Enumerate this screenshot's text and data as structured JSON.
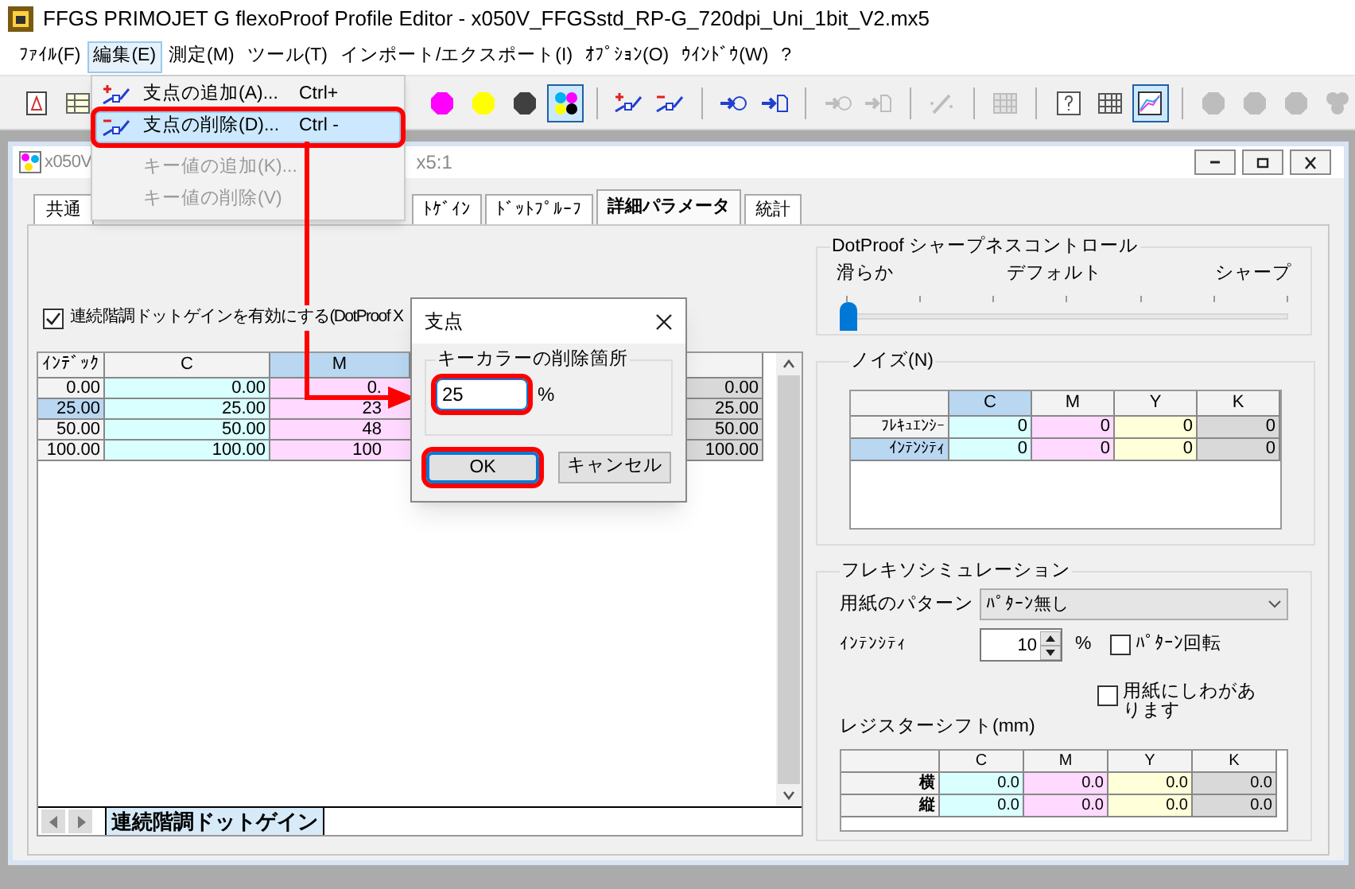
{
  "window": {
    "title": "FFGS PRIMOJET G flexoProof Profile Editor - x050V_FFGSstd_RP-G_720dpi_Uni_1bit_V2.mx5"
  },
  "menu_bar": [
    {
      "label": "ﾌｧｲﾙ(F)",
      "selected": false
    },
    {
      "label": "編集(E)",
      "selected": true
    },
    {
      "label": "測定(M)",
      "selected": false
    },
    {
      "label": "ツール(T)",
      "selected": false
    },
    {
      "label": "インポート/エクスポート(I)",
      "selected": false
    },
    {
      "label": "ｵﾌﾟｼｮﾝ(O)",
      "selected": false
    },
    {
      "label": "ｳｲﾝﾄﾞｳ(W)",
      "selected": false
    },
    {
      "label": "?",
      "selected": false
    }
  ],
  "toolbar": [
    {
      "kind": "document",
      "selected": false,
      "disabled": false
    },
    {
      "kind": "table",
      "selected": false,
      "disabled": false
    },
    {
      "kind": "gap"
    },
    {
      "kind": "dot",
      "color": "#ff00ff",
      "selected": false,
      "disabled": false
    },
    {
      "kind": "dot",
      "color": "#ffff00",
      "selected": false,
      "disabled": false
    },
    {
      "kind": "dot",
      "color": "#404040",
      "selected": false,
      "disabled": false
    },
    {
      "kind": "cmyk",
      "selected": true,
      "disabled": false
    },
    {
      "kind": "separator"
    },
    {
      "kind": "add-point",
      "selected": false,
      "disabled": false
    },
    {
      "kind": "delete-point",
      "selected": false,
      "disabled": false
    },
    {
      "kind": "separator"
    },
    {
      "kind": "import",
      "selected": false,
      "disabled": false
    },
    {
      "kind": "export",
      "selected": false,
      "disabled": false
    },
    {
      "kind": "separator"
    },
    {
      "kind": "import",
      "selected": false,
      "disabled": true
    },
    {
      "kind": "export",
      "selected": false,
      "disabled": true
    },
    {
      "kind": "separator"
    },
    {
      "kind": "wand",
      "selected": false,
      "disabled": true
    },
    {
      "kind": "separator"
    },
    {
      "kind": "grid",
      "selected": false,
      "disabled": true
    },
    {
      "kind": "separator"
    },
    {
      "kind": "help",
      "selected": false,
      "disabled": false
    },
    {
      "kind": "grid",
      "selected": false,
      "disabled": false
    },
    {
      "kind": "chart",
      "selected": true,
      "disabled": false
    },
    {
      "kind": "separator"
    },
    {
      "kind": "dot",
      "selected": false,
      "disabled": true
    },
    {
      "kind": "dot",
      "selected": false,
      "disabled": true
    },
    {
      "kind": "dot",
      "selected": false,
      "disabled": true
    },
    {
      "kind": "cluster",
      "selected": false,
      "disabled": true
    }
  ],
  "edit_menu": [
    {
      "kind": "add-point",
      "label": "支点の追加(A)...",
      "shortcut": "Ctrl+",
      "disabled": false,
      "selected": false,
      "highlighted": false
    },
    {
      "kind": "delete-point",
      "label": "支点の削除(D)...",
      "shortcut": "Ctrl -",
      "disabled": false,
      "selected": true,
      "highlighted": true
    },
    {
      "kind": "plain",
      "label": "キー値の追加(K)...",
      "disabled": true,
      "selected": false,
      "highlighted": false
    },
    {
      "kind": "plain",
      "label": "キー値の削除(V)",
      "disabled": true,
      "selected": false,
      "highlighted": false
    }
  ],
  "document": {
    "title_start": "x050V",
    "title_end": "x5:1",
    "tabs": [
      {
        "label": "共通",
        "selected": false
      },
      {
        "kind": "hidden"
      },
      {
        "label": "ﾄｹﾞｲﾝ",
        "selected": false
      },
      {
        "label": "ﾄﾞｯﾄﾌﾟﾙｰﾌ",
        "selected": false
      },
      {
        "label": "詳細パラメータ",
        "selected": true
      },
      {
        "label": "統計",
        "selected": false
      }
    ],
    "tone_gain": {
      "checkbox": {
        "label": "連続階調ドットゲインを有効にする(DotProof X",
        "checked": true
      },
      "columns": [
        {
          "label": "ｲﾝﾃﾞｯｸ",
          "selected": false
        },
        {
          "label": "C",
          "selected": false
        },
        {
          "label": "M",
          "selected": true
        }
      ],
      "rows": [
        {
          "index": "0.00",
          "selected": false,
          "c": "0.00",
          "m": "0.",
          "column_5": "0.00"
        },
        {
          "index": "25.00",
          "selected": true,
          "c": "25.00",
          "m": "23",
          "column_5": "25.00"
        },
        {
          "index": "50.00",
          "selected": false,
          "c": "50.00",
          "m": "48",
          "column_5": "50.00"
        },
        {
          "index": "100.00",
          "selected": false,
          "c": "100.00",
          "m": "100",
          "column_5": "100.00"
        }
      ],
      "sheet_tabs": [
        {
          "label": "連続階調ドットゲイン",
          "selected": true
        }
      ]
    },
    "sharpness": {
      "title": "DotProof シャープネスコントロール",
      "labels": [
        "滑らか",
        "デフォルト",
        "シャープ"
      ],
      "level": 0
    },
    "noise": {
      "title": "ノイズ(N)",
      "columns": [
        {
          "label": "C",
          "selected": true
        },
        {
          "label": "M",
          "selected": false
        },
        {
          "label": "Y",
          "selected": false
        },
        {
          "label": "K",
          "selected": false
        }
      ],
      "rows": [
        {
          "label": "ﾌﾚｷｭｴﾝｼｰ",
          "selected": false,
          "values": [
            "0",
            "0",
            "0",
            "0"
          ]
        },
        {
          "label": "ｲﾝﾃﾝｼﾃｨ",
          "selected": true,
          "values": [
            "0",
            "0",
            "0",
            "0"
          ]
        }
      ]
    },
    "flexo": {
      "title": "フレキソシミュレーション",
      "paper_pattern": {
        "label": "用紙のパターン",
        "value": "ﾊﾟﾀｰﾝ無し"
      },
      "intensity": {
        "label": "ｲﾝﾃﾝｼﾃｨ",
        "value": "10",
        "unit": "%"
      },
      "pattern_rotate": {
        "label": "ﾊﾟﾀｰﾝ回転",
        "checked": false
      },
      "wrinkles": {
        "label": "用紙にしわがあります",
        "checked": false
      },
      "register_shift": {
        "label": "レジスターシフト(mm)",
        "columns": [
          "C",
          "M",
          "Y",
          "K"
        ],
        "rows": [
          {
            "label": "横",
            "values": [
              "0.0",
              "0.0",
              "0.0",
              "0.0"
            ]
          },
          {
            "label": "縦",
            "values": [
              "0.0",
              "0.0",
              "0.0",
              "0.0"
            ]
          }
        ]
      }
    }
  },
  "dialog": {
    "title": "支点",
    "group": "キーカラーの削除箇所",
    "input": {
      "value": "25",
      "highlighted": true
    },
    "unit": "%",
    "buttons": [
      {
        "label": "OK",
        "default": true,
        "highlighted": true
      },
      {
        "label": "キャンセル",
        "default": false,
        "highlighted": false
      }
    ]
  }
}
